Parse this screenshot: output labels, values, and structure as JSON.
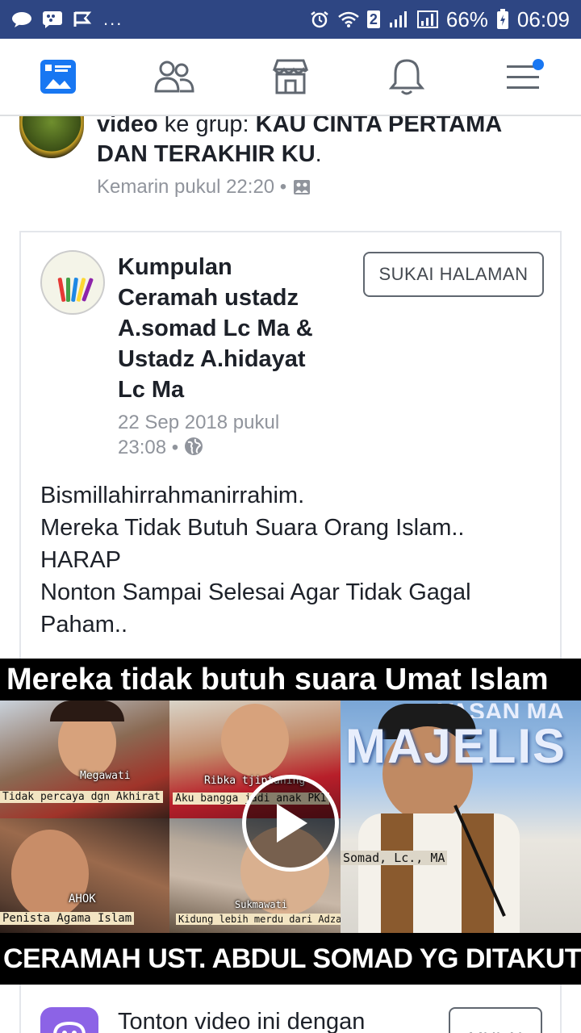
{
  "status_bar": {
    "dots": "...",
    "sim_badge": "2",
    "battery": "66%",
    "time": "06:09"
  },
  "nav": {
    "items": [
      "news-feed",
      "friends",
      "marketplace",
      "notifications",
      "menu"
    ]
  },
  "top_story": {
    "text_prefix": "video",
    "text_mid": " ke grup: ",
    "group_name": "KAU CINTA PERTAMA DAN TERAKHIR KU",
    "text_suffix": ".",
    "meta": "Kemarin pukul 22:20 •"
  },
  "shared_post": {
    "page_name": "Kumpulan Ceramah ustadz A.somad Lc Ma & Ustadz A.hidayat Lc Ma",
    "like_button": "SUKAI HALAMAN",
    "date_line1": "22 Sep 2018 pukul",
    "date_line2": "23:08 •",
    "body_lines": [
      "Bismillahirrahmanirrahim.",
      "Mereka Tidak Butuh Suara Orang Islam..",
      "HARAP",
      "Nonton Sampai Selesai Agar Tidak Gagal",
      "Paham.."
    ]
  },
  "video": {
    "title": "Mereka tidak butuh suara Umat Islam",
    "footer": "CERAMAH UST. ABDUL SOMAD YG DITAKUTI ORANG MUNAFIK",
    "captions": {
      "megawati_name": "Megawati",
      "megawati_quote": "Tidak percaya dgn Akhirat",
      "ribka_name": "Ribka tjiptaning",
      "ribka_quote": "Aku bangga jadi anak PKI",
      "ahok_name": "AHOK",
      "ahok_quote": "Penista Agama Islam",
      "sukmawati_name": "Sukmawati",
      "sukmawati_quote": "Kidung lebih merdu dari Adzan",
      "somad_name": "Somad, Lc., MA",
      "banner": "MAJELIS",
      "banner_top": "YASAN MA"
    }
  },
  "promo": {
    "text": "Tonton video ini dengan",
    "button": "MULAI"
  }
}
